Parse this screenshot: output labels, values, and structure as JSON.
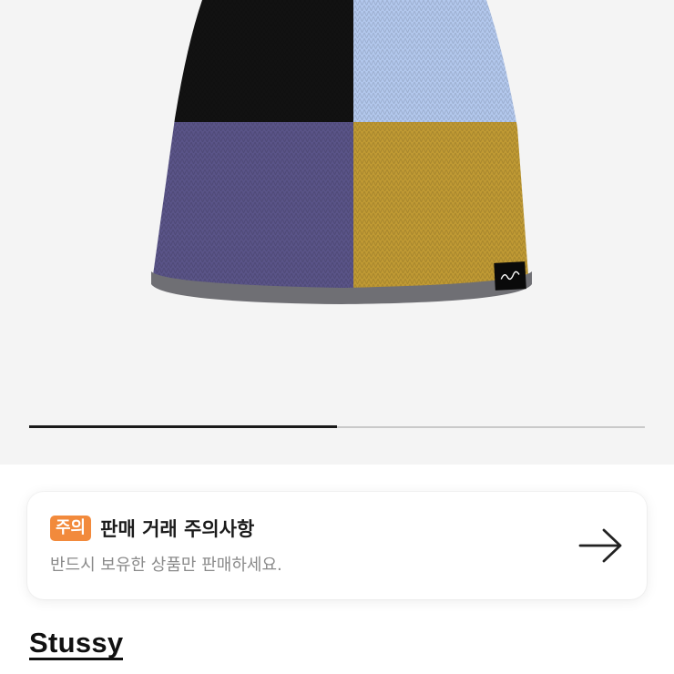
{
  "gallery": {
    "image_alt": "Stussy color-block knit beanie",
    "progress_fraction": 0.5,
    "colors": {
      "black": "#121212",
      "light_blue": "#b3c8ed",
      "purple": "#5a5488",
      "mustard": "#c09a34",
      "grey_trim": "#6f6f74",
      "label": "#0a0a0a"
    }
  },
  "notice": {
    "badge": "주의",
    "title": "판매 거래 주의사항",
    "subtitle": "반드시 보유한 상품만 판매하세요.",
    "arrow_icon": "arrow-right-icon"
  },
  "brand": {
    "name": "Stussy"
  }
}
